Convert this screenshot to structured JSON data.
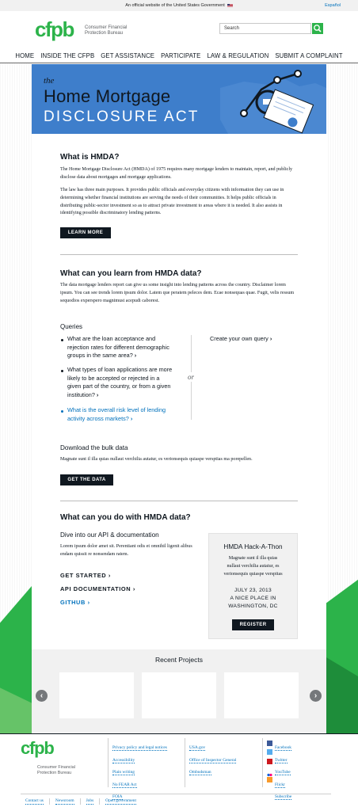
{
  "banner": {
    "text": "An official website of the United States Government",
    "espanol": "Español"
  },
  "header": {
    "logo": "cfpb",
    "logo_sub": "Consumer Financial Protection Bureau",
    "search_placeholder": "Search"
  },
  "nav": [
    "HOME",
    "INSIDE THE CFPB",
    "GET ASSISTANCE",
    "PARTICIPATE",
    "LAW & REGULATION",
    "SUBMIT A COMPLAINT"
  ],
  "hero": {
    "the": "the",
    "title": "Home Mortgage",
    "subtitle": "DISCLOSURE ACT"
  },
  "what_is": {
    "heading": "What is HMDA?",
    "p1": "The Home Mortgage Disclosure Act (HMDA) of 1975 requires many mortgage lenders to maintain, report, and publicly disclose data about mortgages and mortgage applications.",
    "p2": "The law has three main purposes. It provides public officials and everyday citizens with information they can use in determining whether financial institutions are serving the needs of their communities. It helps public officials in distributing public-sector investment so as to attract private investment to areas where it is needed. It also assists in identifying possible discriminatory lending patterns.",
    "button": "LEARN MORE"
  },
  "learn": {
    "heading": "What can you learn from HMDA data?",
    "p": "The data mortgage lenders report can give us some insight into lending patterns across the country. Disclaimer lorem ipsum. You can see trends lorem ipsum dolor. Latem que peratem peleces dem. Ecae nonsequas quae. Fugit, velis ressum sequodios experspero magnimust acepudi caborest.",
    "queries_heading": "Queries",
    "queries": [
      {
        "lines": [
          "What are the loan acceptance and",
          "rejection rates for different demographic",
          "groups in the same area?"
        ]
      },
      {
        "lines": [
          "What types of loan applications are more",
          "likely to be accepted or rejected in a",
          "given part of the country, or from a given",
          "institution?"
        ]
      },
      {
        "lines": [
          "What is the overall risk level of lending",
          "activity across markets?"
        ]
      }
    ],
    "or": "or",
    "own_query": "Create your own query",
    "download_heading": "Download the bulk data",
    "download_p": "Magnate sunt il illa quias nullaut verchilia autatur, es verionsequis quiaspe versptias ma porepellen.",
    "download_button": "GET THE DATA"
  },
  "do": {
    "heading": "What can you do with HMDA data?",
    "api_heading": "Dive into our API & documentation",
    "api_p": "Lorem ipsum dolor amet sit. Perentiant odis et omnihil ligenit alibus endam quissit re nonsendam ratem.",
    "links": [
      "GET STARTED",
      "API DOCUMENTATION",
      "GITHUB"
    ],
    "hack": {
      "title": "HMDA Hack-A-Thon",
      "desc": [
        "Magnate sunt il illa quias",
        "nullaut verchilia autatur, es",
        "verionsequis quiaspe verspitas"
      ],
      "date": "JULY 23, 2013",
      "place1": "A NICE PLACE IN",
      "place2": "WASHINGTON, DC",
      "button": "REGISTER"
    }
  },
  "recent": {
    "heading": "Recent Projects"
  },
  "footer": {
    "logo": "cfpb",
    "logo_sub": "Consumer Financial Protection Bureau",
    "col1": [
      "Privacy policy and legal notices",
      "Accessibility",
      "Plain writing",
      "No FEAR Act",
      "FOIA"
    ],
    "col2": [
      "USA.gov",
      "Office of Inspector General",
      "Ombudsman"
    ],
    "social": [
      "Facebook",
      "Twitter",
      "YouTube",
      "Flickr",
      "Subscribe"
    ],
    "bottom": [
      "Contact us",
      "Newsroom",
      "Jobs",
      "Open government"
    ]
  },
  "colors": {
    "green": "#2cb34a",
    "navy": "#101820",
    "blue": "#0071bc",
    "hero": "#3e7ecb"
  }
}
